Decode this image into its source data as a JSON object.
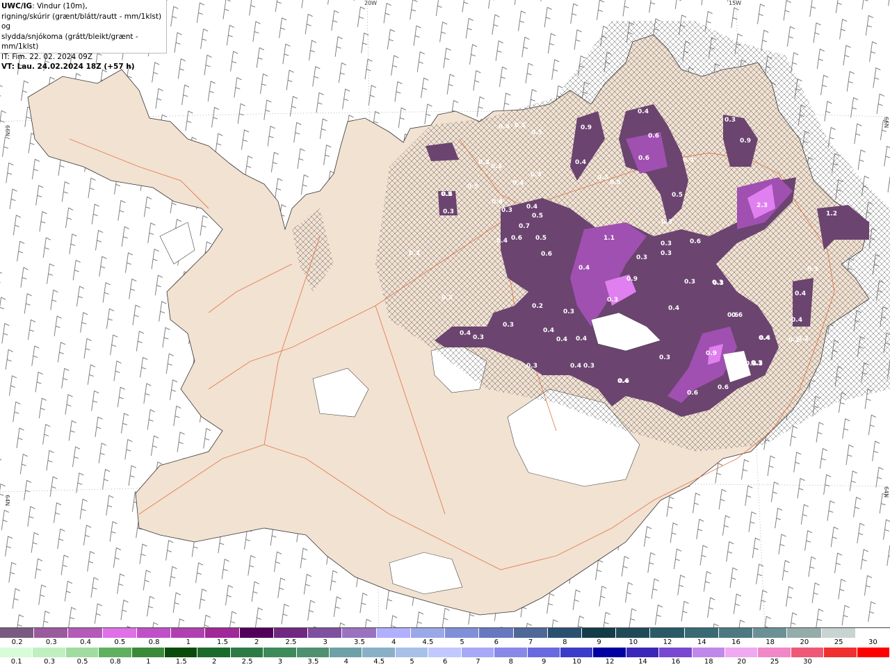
{
  "title": {
    "prefix": "UWC/IG",
    "line1": ": Vindur (10m),",
    "line2": "rigning/skúrir (grænt/blátt/rautt - mm/1klst) og",
    "line3": "slydda/snjókoma (grátt/bleikt/grænt - mm/1klst)",
    "it": "IT: Fim. 22. 02. 2024 09Z",
    "vt": "VT: Lau. 24.02.2024 18Z (+57 h)"
  },
  "axis_labels": {
    "lon_top": [
      "20W",
      "15W"
    ],
    "lat_left": [
      "66N",
      "64N"
    ],
    "lat_right": [
      "66N",
      "64N"
    ]
  },
  "precip_values": [
    "0.4",
    "0.5",
    "0.5",
    "0.9",
    "0.4",
    "0.6",
    "0.6",
    "0.4",
    "0.3",
    "0.3",
    "0.5",
    "0.4",
    "0.3",
    "0.3",
    "0.4",
    "0.4",
    "0.5",
    "0.5",
    "0.3",
    "0.4",
    "0.3",
    "0.7",
    "0.6",
    "0.5",
    "1.1",
    "0.4",
    "0.3",
    "0.3",
    "0.6",
    "0.3",
    "0.5",
    "0.6",
    "0.4",
    "0.9",
    "0.9",
    "0.3",
    "0.3",
    "0.3",
    "0.4",
    "0.2",
    "0.3",
    "0.4",
    "0.4",
    "0.4",
    "0.4",
    "0.3",
    "0.4",
    "0.3",
    "0.3",
    "0.4",
    "0.3",
    "0.6",
    "0.4",
    "0.9",
    "0.4",
    "0.3",
    "0.2",
    "0.3",
    "0.6",
    "0.3",
    "0.4",
    "0.3",
    "0.3",
    "2.3",
    "1.2",
    "0.3",
    "0.3",
    "0.4",
    "0.2",
    "0.3",
    "0.4",
    "0.3",
    "0.6",
    "0.6",
    "0.5",
    "0.4",
    "0.3",
    "0.6"
  ],
  "colorbar_top": {
    "colors": [
      "#7a5a82",
      "#9a5a9e",
      "#b45ab8",
      "#e070e8",
      "#c050c8",
      "#b040b0",
      "#a02898",
      "#50005a",
      "#702880",
      "#8050a0",
      "#9a72c0",
      "#b0b0ff",
      "#9aa8e8",
      "#8090d8",
      "#6878c0",
      "#4e6898",
      "#2a5070",
      "#143c48",
      "#204a58",
      "#2a5a68",
      "#3a6a74",
      "#4c7a80",
      "#6a9296",
      "#94acaa",
      "#c8d4d2",
      "#ffffff"
    ],
    "labels": [
      "0.2",
      "0.3",
      "0.4",
      "0.5",
      "0.8",
      "1",
      "1.5",
      "2",
      "2.5",
      "3",
      "3.5",
      "4",
      "4.5",
      "5",
      "6",
      "7",
      "8",
      "9",
      "10",
      "12",
      "14",
      "16",
      "18",
      "20",
      "25",
      "30"
    ]
  },
  "colorbar_bottom": {
    "colors": [
      "#d8fcd8",
      "#c0f0c0",
      "#a0dca0",
      "#60b060",
      "#3a8a3a",
      "#0a4a0a",
      "#1c6a2c",
      "#2e7a46",
      "#3e8a5a",
      "#4e9070",
      "#6ea0a8",
      "#8ab0c8",
      "#a8c0e8",
      "#c0c8ff",
      "#a8a8f8",
      "#8888e8",
      "#6a6ae0",
      "#3c3cc8",
      "#0000a0",
      "#3c28b8",
      "#7848d0",
      "#c088e8",
      "#f0a8f0",
      "#f088c8",
      "#f05878",
      "#f03030",
      "#ff0000"
    ],
    "labels": [
      "0.1",
      "0.3",
      "0.5",
      "0.8",
      "1",
      "1.5",
      "2",
      "2.5",
      "3",
      "3.5",
      "4",
      "4.5",
      "5",
      "6",
      "7",
      "8",
      "9",
      "10",
      "12",
      "14",
      "16",
      "18",
      "20",
      "25",
      "30"
    ]
  },
  "colors": {
    "land": "#f2e2d2",
    "glacier": "#ffffff",
    "roads": "#e06a3a",
    "precip_light": "#6b4470",
    "precip_mid": "#a050b0",
    "precip_high": "#e080f0"
  }
}
